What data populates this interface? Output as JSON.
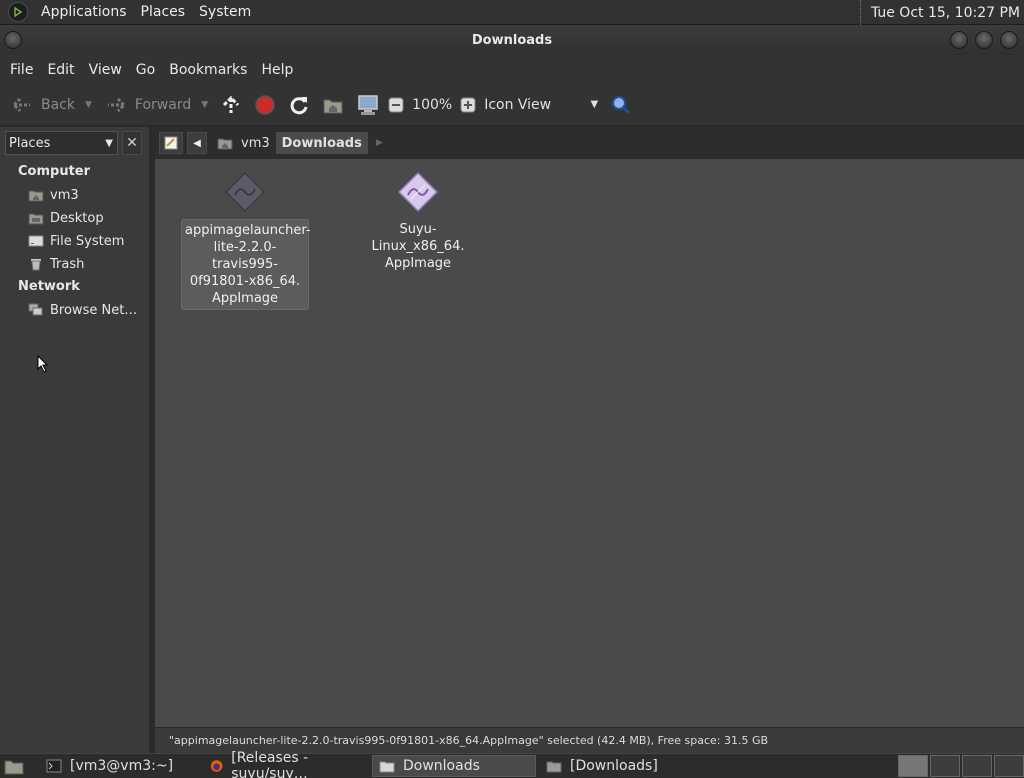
{
  "top_panel": {
    "menus": [
      "Applications",
      "Places",
      "System"
    ],
    "clock": "Tue Oct 15, 10:27 PM"
  },
  "window": {
    "title": "Downloads"
  },
  "menubar": [
    "File",
    "Edit",
    "View",
    "Go",
    "Bookmarks",
    "Help"
  ],
  "toolbar": {
    "back": "Back",
    "forward": "Forward",
    "zoom": "100%",
    "view_mode": "Icon View"
  },
  "sidebar": {
    "selector": "Places",
    "computer_heading": "Computer",
    "network_heading": "Network",
    "items": [
      "vm3",
      "Desktop",
      "File System",
      "Trash"
    ],
    "network_items": [
      "Browse Net…"
    ]
  },
  "location": {
    "crumbs": [
      "vm3",
      "Downloads"
    ]
  },
  "files": [
    {
      "name_lines": [
        "appimagelauncher-",
        "lite-2.2.0-travis995-",
        "0f91801-x86_64.",
        "AppImage"
      ],
      "selected": true
    },
    {
      "name_lines": [
        "Suyu-Linux_x86_64.",
        "AppImage"
      ],
      "selected": false
    }
  ],
  "status": "\"appimagelauncher-lite-2.2.0-travis995-0f91801-x86_64.AppImage\" selected (42.4 MB), Free space: 31.5 GB",
  "taskbar": [
    "[vm3@vm3:~]",
    "[Releases - suyu/suy…",
    "Downloads",
    "[Downloads]"
  ],
  "colors": {
    "accent": "#4a4a4a",
    "stop": "#cc2b2b"
  }
}
